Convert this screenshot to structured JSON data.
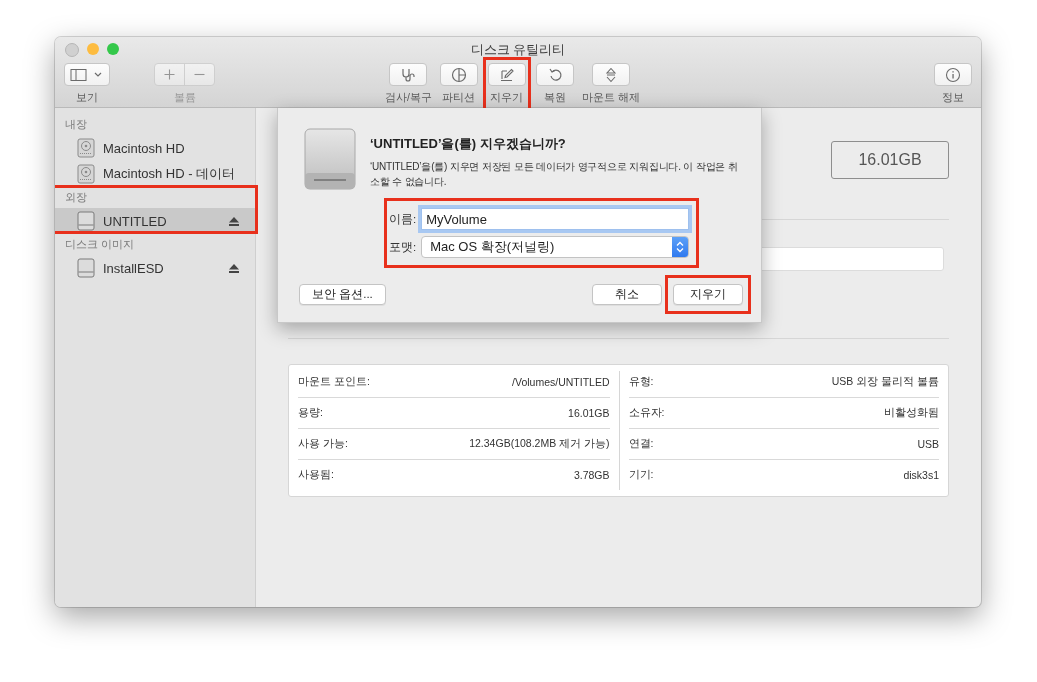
{
  "window": {
    "title": "디스크 유틸리티"
  },
  "toolbar": {
    "left": [
      {
        "label": "보기",
        "kind": "sidebar-toggle",
        "disabled": false,
        "highlighted": false
      },
      {
        "label": "볼륨",
        "kind": "add-remove",
        "disabled": true,
        "highlighted": false
      }
    ],
    "center": [
      {
        "label": "검사/복구",
        "kind": "first-aid",
        "disabled": false,
        "highlighted": false
      },
      {
        "label": "파티션",
        "kind": "partition",
        "disabled": false,
        "highlighted": false
      },
      {
        "label": "지우기",
        "kind": "erase",
        "disabled": false,
        "highlighted": true
      },
      {
        "label": "복원",
        "kind": "restore",
        "disabled": false,
        "highlighted": false
      },
      {
        "label": "마운트 해제",
        "kind": "unmount",
        "disabled": false,
        "highlighted": false
      }
    ],
    "right": [
      {
        "label": "정보",
        "kind": "info",
        "disabled": false,
        "highlighted": false
      }
    ]
  },
  "sidebar": {
    "sections": [
      {
        "title": "내장",
        "highlighted": false,
        "items": [
          {
            "name": "Macintosh HD",
            "kind": "internal",
            "eject": false,
            "selected": false
          },
          {
            "name": "Macintosh HD - 데이터",
            "kind": "internal",
            "eject": false,
            "selected": false
          }
        ]
      },
      {
        "title": "외장",
        "highlighted": true,
        "items": [
          {
            "name": "UNTITLED",
            "kind": "external",
            "eject": true,
            "selected": true
          }
        ]
      },
      {
        "title": "디스크 이미지",
        "highlighted": false,
        "items": [
          {
            "name": "InstallESD",
            "kind": "external",
            "eject": true,
            "selected": false
          }
        ]
      }
    ]
  },
  "main": {
    "capacity": "16.01GB",
    "info_left": [
      {
        "label": "마운트 포인트:",
        "value": "/Volumes/UNTITLED"
      },
      {
        "label": "용량:",
        "value": "16.01GB"
      },
      {
        "label": "사용 가능:",
        "value": "12.34GB(108.2MB 제거 가능)"
      },
      {
        "label": "사용됨:",
        "value": "3.78GB"
      }
    ],
    "info_right": [
      {
        "label": "유형:",
        "value": "USB 외장 물리적 볼륨"
      },
      {
        "label": "소유자:",
        "value": "비활성화됨"
      },
      {
        "label": "연결:",
        "value": "USB"
      },
      {
        "label": "기기:",
        "value": "disk3s1"
      }
    ]
  },
  "dialog": {
    "title": "‘UNTITLED’을(를) 지우겠습니까?",
    "message": "‘UNTITLED’을(를) 지우면 저장된 모든 데이터가 영구적으로 지워집니다. 이 작업은 취소할 수 없습니다.",
    "form_highlighted": true,
    "name_label": "이름:",
    "name_value": "MyVolume",
    "format_label": "포맷:",
    "format_value": "Mac OS 확장(저널링)",
    "buttons": [
      {
        "label": "보안 옵션...",
        "kind": "option",
        "highlighted": false
      },
      {
        "label": "취소",
        "kind": "action",
        "highlighted": false
      },
      {
        "label": "지우기",
        "kind": "action",
        "highlighted": true
      }
    ]
  }
}
